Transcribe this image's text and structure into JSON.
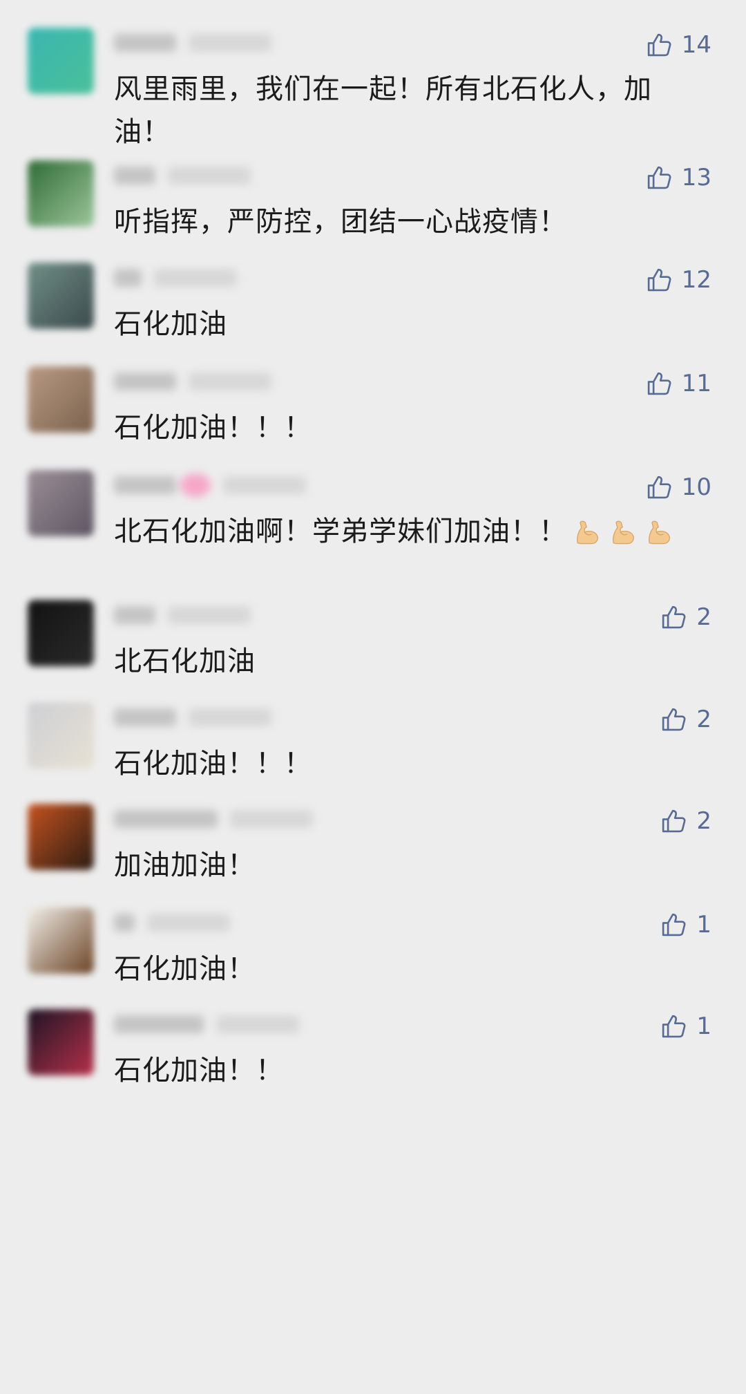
{
  "comments": [
    {
      "text": "风里雨里，我们在一起！所有北石化人，加油！",
      "likes": "14",
      "avatar_colors": [
        "#39b7b1",
        "#4bbf9a"
      ],
      "name_w": 90,
      "time_w": 120,
      "heart": false
    },
    {
      "text": "听指挥，严防控，团结一心战疫情！",
      "likes": "13",
      "avatar_colors": [
        "#2f6b35",
        "#9cc59a"
      ],
      "name_w": 60,
      "time_w": 120,
      "heart": false
    },
    {
      "text": "石化加油",
      "likes": "12",
      "avatar_colors": [
        "#6f8f86",
        "#3b4a4c"
      ],
      "name_w": 40,
      "time_w": 120,
      "heart": false
    },
    {
      "text": "石化加油！！！",
      "likes": "11",
      "avatar_colors": [
        "#b89a82",
        "#7b624e"
      ],
      "name_w": 90,
      "time_w": 120,
      "heart": false
    },
    {
      "text": "北石化加油啊！学弟学妹们加油！！",
      "likes": "10",
      "avatar_colors": [
        "#9a8f96",
        "#5e5563"
      ],
      "name_w": 90,
      "time_w": 120,
      "heart": true,
      "emoji_count": 3
    },
    {
      "text": "北石化加油",
      "likes": "2",
      "avatar_colors": [
        "#121212",
        "#2a2a2a"
      ],
      "name_w": 60,
      "time_w": 120,
      "heart": false
    },
    {
      "text": "石化加油！！！",
      "likes": "2",
      "avatar_colors": [
        "#cfcfd4",
        "#e6e1d3"
      ],
      "name_w": 90,
      "time_w": 120,
      "heart": false
    },
    {
      "text": "加油加油！",
      "likes": "2",
      "avatar_colors": [
        "#c5521f",
        "#2c1c12"
      ],
      "name_w": 150,
      "time_w": 120,
      "heart": false
    },
    {
      "text": "石化加油！",
      "likes": "1",
      "avatar_colors": [
        "#f2f0ea",
        "#6a4224"
      ],
      "name_w": 30,
      "time_w": 120,
      "heart": false
    },
    {
      "text": "石化加油！！",
      "likes": "1",
      "avatar_colors": [
        "#1d1424",
        "#b63049"
      ],
      "name_w": 130,
      "time_w": 120,
      "heart": false
    }
  ]
}
